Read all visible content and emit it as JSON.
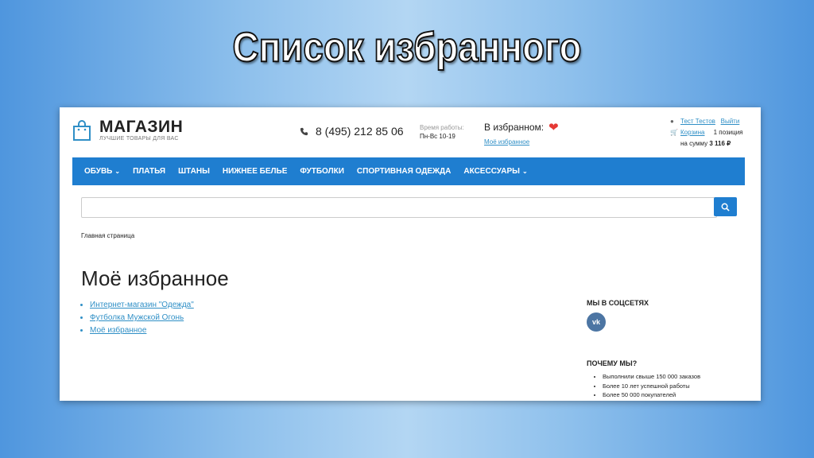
{
  "slide": {
    "title": "Список избранного"
  },
  "header": {
    "logo_title": "МАГАЗИН",
    "logo_subtitle": "ЛУЧШИЕ ТОВАРЫ ДЛЯ ВАС",
    "phone": "8 (495) 212 85 06",
    "hours_label": "Время работы:",
    "hours_value": "Пн-Вс 10-19",
    "favorites_label": "В избранном:",
    "favorites_link": "Моё избранное",
    "user_name": "Тест Тестов",
    "logout": "Выйти",
    "cart_link": "Корзина",
    "cart_count": "1 позиция",
    "cart_sum_label": "на сумму",
    "cart_sum": "3 116 ₽"
  },
  "nav": {
    "items": [
      {
        "label": "ОБУВЬ",
        "dropdown": true
      },
      {
        "label": "ПЛАТЬЯ"
      },
      {
        "label": "ШТАНЫ"
      },
      {
        "label": "НИЖНЕЕ БЕЛЬЕ"
      },
      {
        "label": "ФУТБОЛКИ"
      },
      {
        "label": "СПОРТИВНАЯ ОДЕЖДА"
      },
      {
        "label": "АКСЕССУАРЫ",
        "dropdown": true
      }
    ]
  },
  "search": {
    "value": ""
  },
  "breadcrumb": "Главная страница",
  "page_title": "Моё избранное",
  "links": [
    "Интернет-магазин \"Одежда\"",
    "Футболка Мужской Огонь",
    "Моё избранное"
  ],
  "social": {
    "title": "МЫ В СОЦСЕТЯХ",
    "vk": "vk"
  },
  "why": {
    "title": "ПОЧЕМУ МЫ?",
    "items": [
      "Выполнили свыше 150 000 заказов",
      "Более 10 лет успешной работы",
      "Более 50 000 покупателей"
    ]
  },
  "colors": {
    "accent": "#1f7ed0",
    "link": "#2f8fc6",
    "heart": "#e53935",
    "vk": "#4c75a3"
  },
  "icons": [
    "shopping-bag-icon",
    "phone-icon",
    "heart-icon",
    "user-icon",
    "cart-icon",
    "search-icon",
    "chevron-down-icon",
    "vk-icon"
  ]
}
